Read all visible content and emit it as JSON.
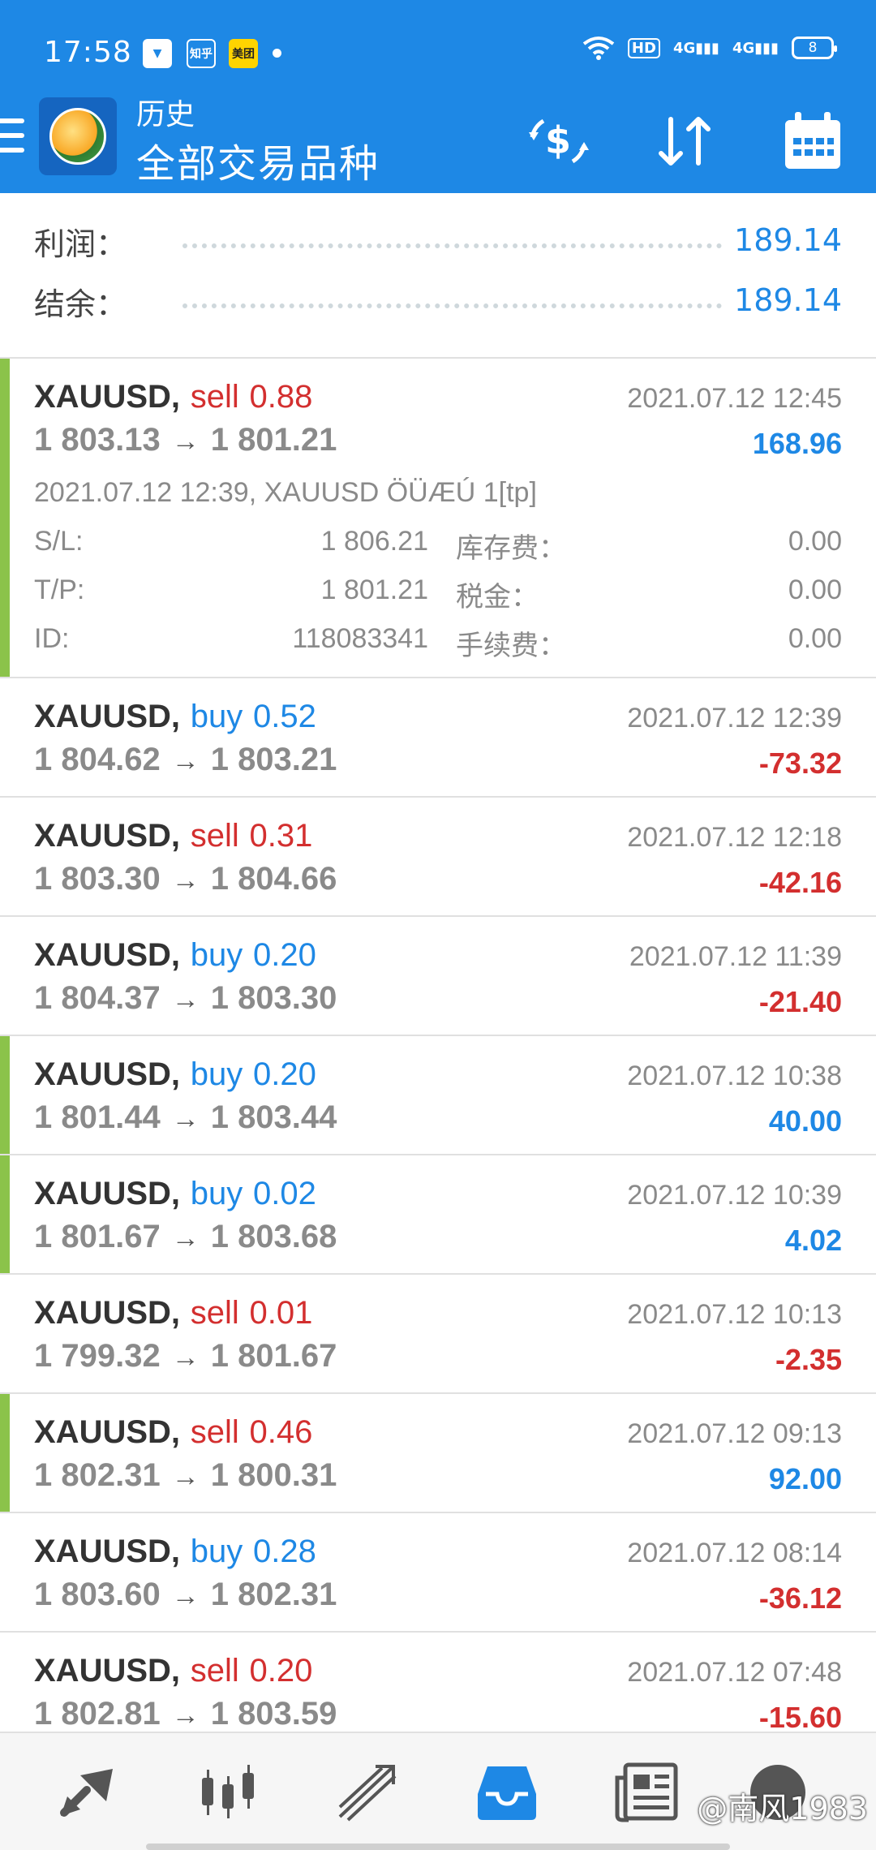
{
  "status_bar": {
    "time": "17:58",
    "notif_icons": [
      "app-notification-icon",
      "zhihu-icon",
      "meituan-icon"
    ],
    "notif_labels": [
      "",
      "知乎",
      "美团"
    ],
    "hd_label": "HD",
    "signal1": "4G",
    "signal2": "4G",
    "battery": "8"
  },
  "app_bar": {
    "subtitle": "历史",
    "title": "全部交易品种"
  },
  "summary": {
    "profit_label": "利润：",
    "profit_value": "189.14",
    "balance_label": "结余：",
    "balance_value": "189.14"
  },
  "colors": {
    "primary": "#1e88e5",
    "sell": "#d32f2f",
    "buy": "#1e88e5",
    "accent_profit": "#8bc34a"
  },
  "trades": [
    {
      "symbol": "XAUUSD,",
      "type": "sell",
      "volume": "0.88",
      "open": "1 803.13",
      "close": "1 801.21",
      "date": "2021.07.12 12:45",
      "profit": "168.96",
      "details": {
        "comment": "2021.07.12 12:39, XAUUSD ÖÜÆÚ 1[tp]",
        "sl_label": "S/L:",
        "sl_value": "1 806.21",
        "swap_label": "库存费：",
        "swap_value": "0.00",
        "tp_label": "T/P:",
        "tp_value": "1 801.21",
        "tax_label": "税金：",
        "tax_value": "0.00",
        "id_label": "ID:",
        "id_value": "118083341",
        "fee_label": "手续费：",
        "fee_value": "0.00"
      }
    },
    {
      "symbol": "XAUUSD,",
      "type": "buy",
      "volume": "0.52",
      "open": "1 804.62",
      "close": "1 803.21",
      "date": "2021.07.12 12:39",
      "profit": "-73.32"
    },
    {
      "symbol": "XAUUSD,",
      "type": "sell",
      "volume": "0.31",
      "open": "1 803.30",
      "close": "1 804.66",
      "date": "2021.07.12 12:18",
      "profit": "-42.16"
    },
    {
      "symbol": "XAUUSD,",
      "type": "buy",
      "volume": "0.20",
      "open": "1 804.37",
      "close": "1 803.30",
      "date": "2021.07.12 11:39",
      "profit": "-21.40"
    },
    {
      "symbol": "XAUUSD,",
      "type": "buy",
      "volume": "0.20",
      "open": "1 801.44",
      "close": "1 803.44",
      "date": "2021.07.12 10:38",
      "profit": "40.00"
    },
    {
      "symbol": "XAUUSD,",
      "type": "buy",
      "volume": "0.02",
      "open": "1 801.67",
      "close": "1 803.68",
      "date": "2021.07.12 10:39",
      "profit": "4.02"
    },
    {
      "symbol": "XAUUSD,",
      "type": "sell",
      "volume": "0.01",
      "open": "1 799.32",
      "close": "1 801.67",
      "date": "2021.07.12 10:13",
      "profit": "-2.35"
    },
    {
      "symbol": "XAUUSD,",
      "type": "sell",
      "volume": "0.46",
      "open": "1 802.31",
      "close": "1 800.31",
      "date": "2021.07.12 09:13",
      "profit": "92.00"
    },
    {
      "symbol": "XAUUSD,",
      "type": "buy",
      "volume": "0.28",
      "open": "1 803.60",
      "close": "1 802.31",
      "date": "2021.07.12 08:14",
      "profit": "-36.12"
    },
    {
      "symbol": "XAUUSD,",
      "type": "sell",
      "volume": "0.20",
      "open": "1 802.81",
      "close": "1 803.59",
      "date": "2021.07.12 07:48",
      "profit": "-15.60"
    }
  ],
  "bottom_nav": {
    "items": [
      "quotes-icon",
      "chart-candles-icon",
      "trade-icon",
      "history-inbox-icon",
      "news-icon",
      "messages-icon"
    ],
    "active_index": 3,
    "watermark": "@南风1983"
  }
}
